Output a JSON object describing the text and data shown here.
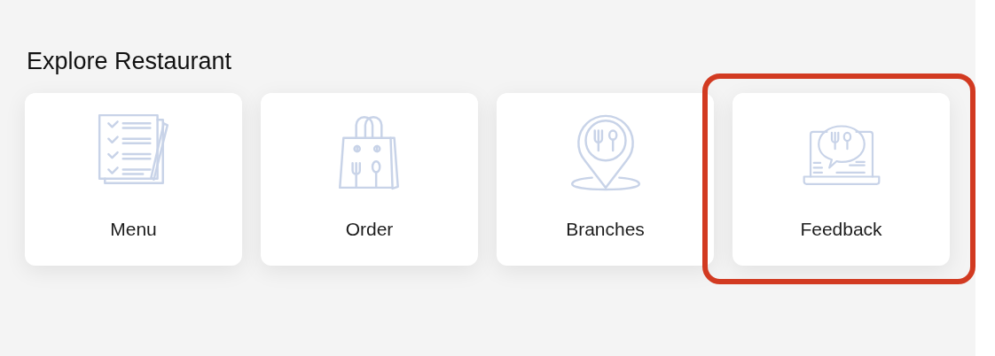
{
  "section": {
    "title": "Explore Restaurant"
  },
  "cards": [
    {
      "label": "Menu",
      "highlighted": false
    },
    {
      "label": "Order",
      "highlighted": false
    },
    {
      "label": "Branches",
      "highlighted": false
    },
    {
      "label": "Feedback",
      "highlighted": true
    }
  ]
}
